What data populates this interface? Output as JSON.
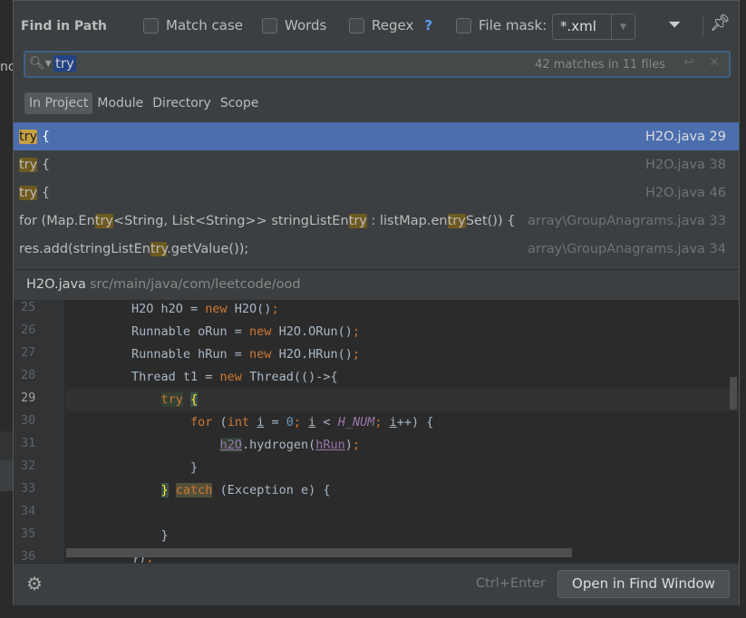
{
  "background": {
    "partial_text": "nc"
  },
  "dialog": {
    "title": "Find in Path",
    "options": [
      {
        "label": "Match case",
        "checked": false
      },
      {
        "label": "Words",
        "checked": false
      },
      {
        "label": "Regex",
        "checked": false,
        "help": "?"
      },
      {
        "label": "File mask:",
        "checked": false
      }
    ],
    "file_mask": "*.xml",
    "search": {
      "value": "try",
      "match_count": "42 matches in 11 files"
    },
    "scopes": [
      "In Project",
      "Module",
      "Directory",
      "Scope"
    ],
    "active_scope": "In Project",
    "results": [
      {
        "pre": "",
        "match": "try",
        "post": " {",
        "file": "H2O.java 29",
        "selected": true
      },
      {
        "pre": "",
        "match": "try",
        "post": " {",
        "file": "H2O.java 38"
      },
      {
        "pre": "",
        "match": "try",
        "post": " {",
        "file": "H2O.java 46"
      },
      {
        "segments": [
          "for (Map.En",
          "try",
          "<String, List<String>> stringListEn",
          "try",
          " : listMap.en",
          "try",
          "Set()) {"
        ],
        "file": "array\\GroupAnagrams.java 33"
      },
      {
        "segments": [
          "res.add(stringListEn",
          "try",
          ".getValue());"
        ],
        "file": "array\\GroupAnagrams.java 34"
      }
    ],
    "preview": {
      "file": "H2O.java",
      "path": "src/main/java/com/leetcode/ood",
      "current_line": 29,
      "lines": [
        {
          "n": 25,
          "tokens": [
            [
              "H2O h2O = ",
              ""
            ],
            [
              "new",
              "kw"
            ],
            [
              " H2O()",
              ""
            ],
            [
              ";",
              "kw"
            ]
          ]
        },
        {
          "n": 26,
          "tokens": [
            [
              "Runnable oRun = ",
              ""
            ],
            [
              "new",
              "kw"
            ],
            [
              " H2O.ORun()",
              ""
            ],
            [
              ";",
              "kw"
            ]
          ]
        },
        {
          "n": 27,
          "tokens": [
            [
              "Runnable hRun = ",
              ""
            ],
            [
              "new",
              "kw"
            ],
            [
              " H2O.HRun()",
              ""
            ],
            [
              ";",
              "kw"
            ]
          ]
        },
        {
          "n": 28,
          "tokens": [
            [
              "Thread t1 = ",
              ""
            ],
            [
              "new",
              "kw"
            ],
            [
              " Thread(()->{",
              ""
            ]
          ]
        },
        {
          "n": 29,
          "tokens": [
            [
              "    ",
              ""
            ],
            [
              "try",
              "kw trybg"
            ],
            [
              " ",
              ""
            ],
            [
              "{",
              "brace"
            ]
          ]
        },
        {
          "n": 30,
          "tokens": [
            [
              "        ",
              ""
            ],
            [
              "for",
              "kw"
            ],
            [
              " (",
              ""
            ],
            [
              "int",
              "kw"
            ],
            [
              " ",
              ""
            ],
            [
              "i",
              "ul"
            ],
            [
              " = ",
              ""
            ],
            [
              "0",
              "num"
            ],
            [
              "; ",
              "kw"
            ],
            [
              "i",
              "ul"
            ],
            [
              " < ",
              ""
            ],
            [
              "H_NUM",
              "const"
            ],
            [
              "; ",
              "kw"
            ],
            [
              "i",
              "ul"
            ],
            [
              "++) {",
              ""
            ]
          ]
        },
        {
          "n": 31,
          "tokens": [
            [
              "            ",
              ""
            ],
            [
              "h2O",
              "fld h2o"
            ],
            [
              ".hydrogen(",
              ""
            ],
            [
              "hRun",
              "fld"
            ],
            [
              ")",
              ""
            ],
            [
              ";",
              "kw"
            ]
          ]
        },
        {
          "n": 32,
          "tokens": [
            [
              "        }",
              ""
            ]
          ]
        },
        {
          "n": 33,
          "tokens": [
            [
              "    ",
              ""
            ],
            [
              "}",
              "brace"
            ],
            [
              " ",
              ""
            ],
            [
              "catch",
              "kw catchbg"
            ],
            [
              " (Exception e) {",
              ""
            ]
          ]
        },
        {
          "n": 34,
          "tokens": []
        },
        {
          "n": 35,
          "tokens": [
            [
              "    }",
              ""
            ]
          ]
        },
        {
          "n": 36,
          "tokens": [
            [
              "})",
              ""
            ],
            [
              ";",
              "kw"
            ]
          ]
        }
      ]
    },
    "footer": {
      "shortcut": "Ctrl+Enter",
      "open_button": "Open in Find Window"
    }
  }
}
